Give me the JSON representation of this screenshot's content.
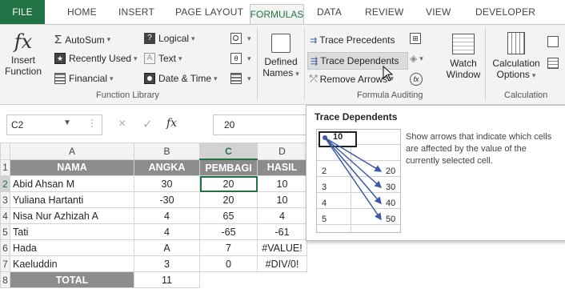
{
  "ribbon_tabs": {
    "file": "FILE",
    "home": "HOME",
    "insert": "INSERT",
    "page_layout": "PAGE LAYOUT",
    "formulas": "FORMULAS",
    "data": "DATA",
    "review": "REVIEW",
    "view": "VIEW",
    "developer": "DEVELOPER"
  },
  "function_library": {
    "insert_function_line1": "Insert",
    "insert_function_line2": "Function",
    "autosum": "AutoSum",
    "recently_used": "Recently Used",
    "financial": "Financial",
    "logical": "Logical",
    "text": "Text",
    "date_time": "Date & Time",
    "group_label": "Function Library"
  },
  "defined_names": {
    "line1": "Defined",
    "line2": "Names"
  },
  "formula_auditing": {
    "trace_precedents": "Trace Precedents",
    "trace_dependents": "Trace Dependents",
    "remove_arrows": "Remove Arrows",
    "watch_window_line1": "Watch",
    "watch_window_line2": "Window",
    "group_label": "Formula Auditing"
  },
  "calculation": {
    "options_line1": "Calculation",
    "options_line2": "Options",
    "group_label": "Calculation"
  },
  "formula_bar": {
    "name_box": "C2",
    "fx_symbol": "fx",
    "value": "20"
  },
  "columns": [
    "A",
    "B",
    "C",
    "D"
  ],
  "rows": [
    {
      "num": "1",
      "cells": [
        "NAMA",
        "ANGKA",
        "PEMBAGI",
        "HASIL"
      ]
    },
    {
      "num": "2",
      "cells": [
        "Abid Ahsan M",
        "30",
        "20",
        "10"
      ]
    },
    {
      "num": "3",
      "cells": [
        "Yuliana Hartanti",
        "-30",
        "20",
        "10"
      ]
    },
    {
      "num": "4",
      "cells": [
        "Nisa Nur Azhizah A",
        "4",
        "65",
        "4"
      ]
    },
    {
      "num": "5",
      "cells": [
        "Tati",
        "4",
        "-65",
        "-61"
      ]
    },
    {
      "num": "6",
      "cells": [
        "Hada",
        "A",
        "7",
        "#VALUE!"
      ]
    },
    {
      "num": "7",
      "cells": [
        "Kaeluddin",
        "3",
        "0",
        "#DIV/0!"
      ]
    },
    {
      "num": "8",
      "cells": [
        "TOTAL",
        "11",
        "",
        ""
      ]
    }
  ],
  "tooltip": {
    "title": "Trace Dependents",
    "description": "Show arrows that indicate which cells are affected by the value of the currently selected cell.",
    "preview_source": "10",
    "preview_rows": [
      {
        "num": "2",
        "value": "20"
      },
      {
        "num": "3",
        "value": "30"
      },
      {
        "num": "4",
        "value": "40"
      },
      {
        "num": "5",
        "value": "50"
      }
    ]
  },
  "colors": {
    "file_tab": "#217346",
    "active_tab_text": "#217346",
    "header_row_fill": "#8c8c8c",
    "arrow": "#3b5ba5"
  }
}
